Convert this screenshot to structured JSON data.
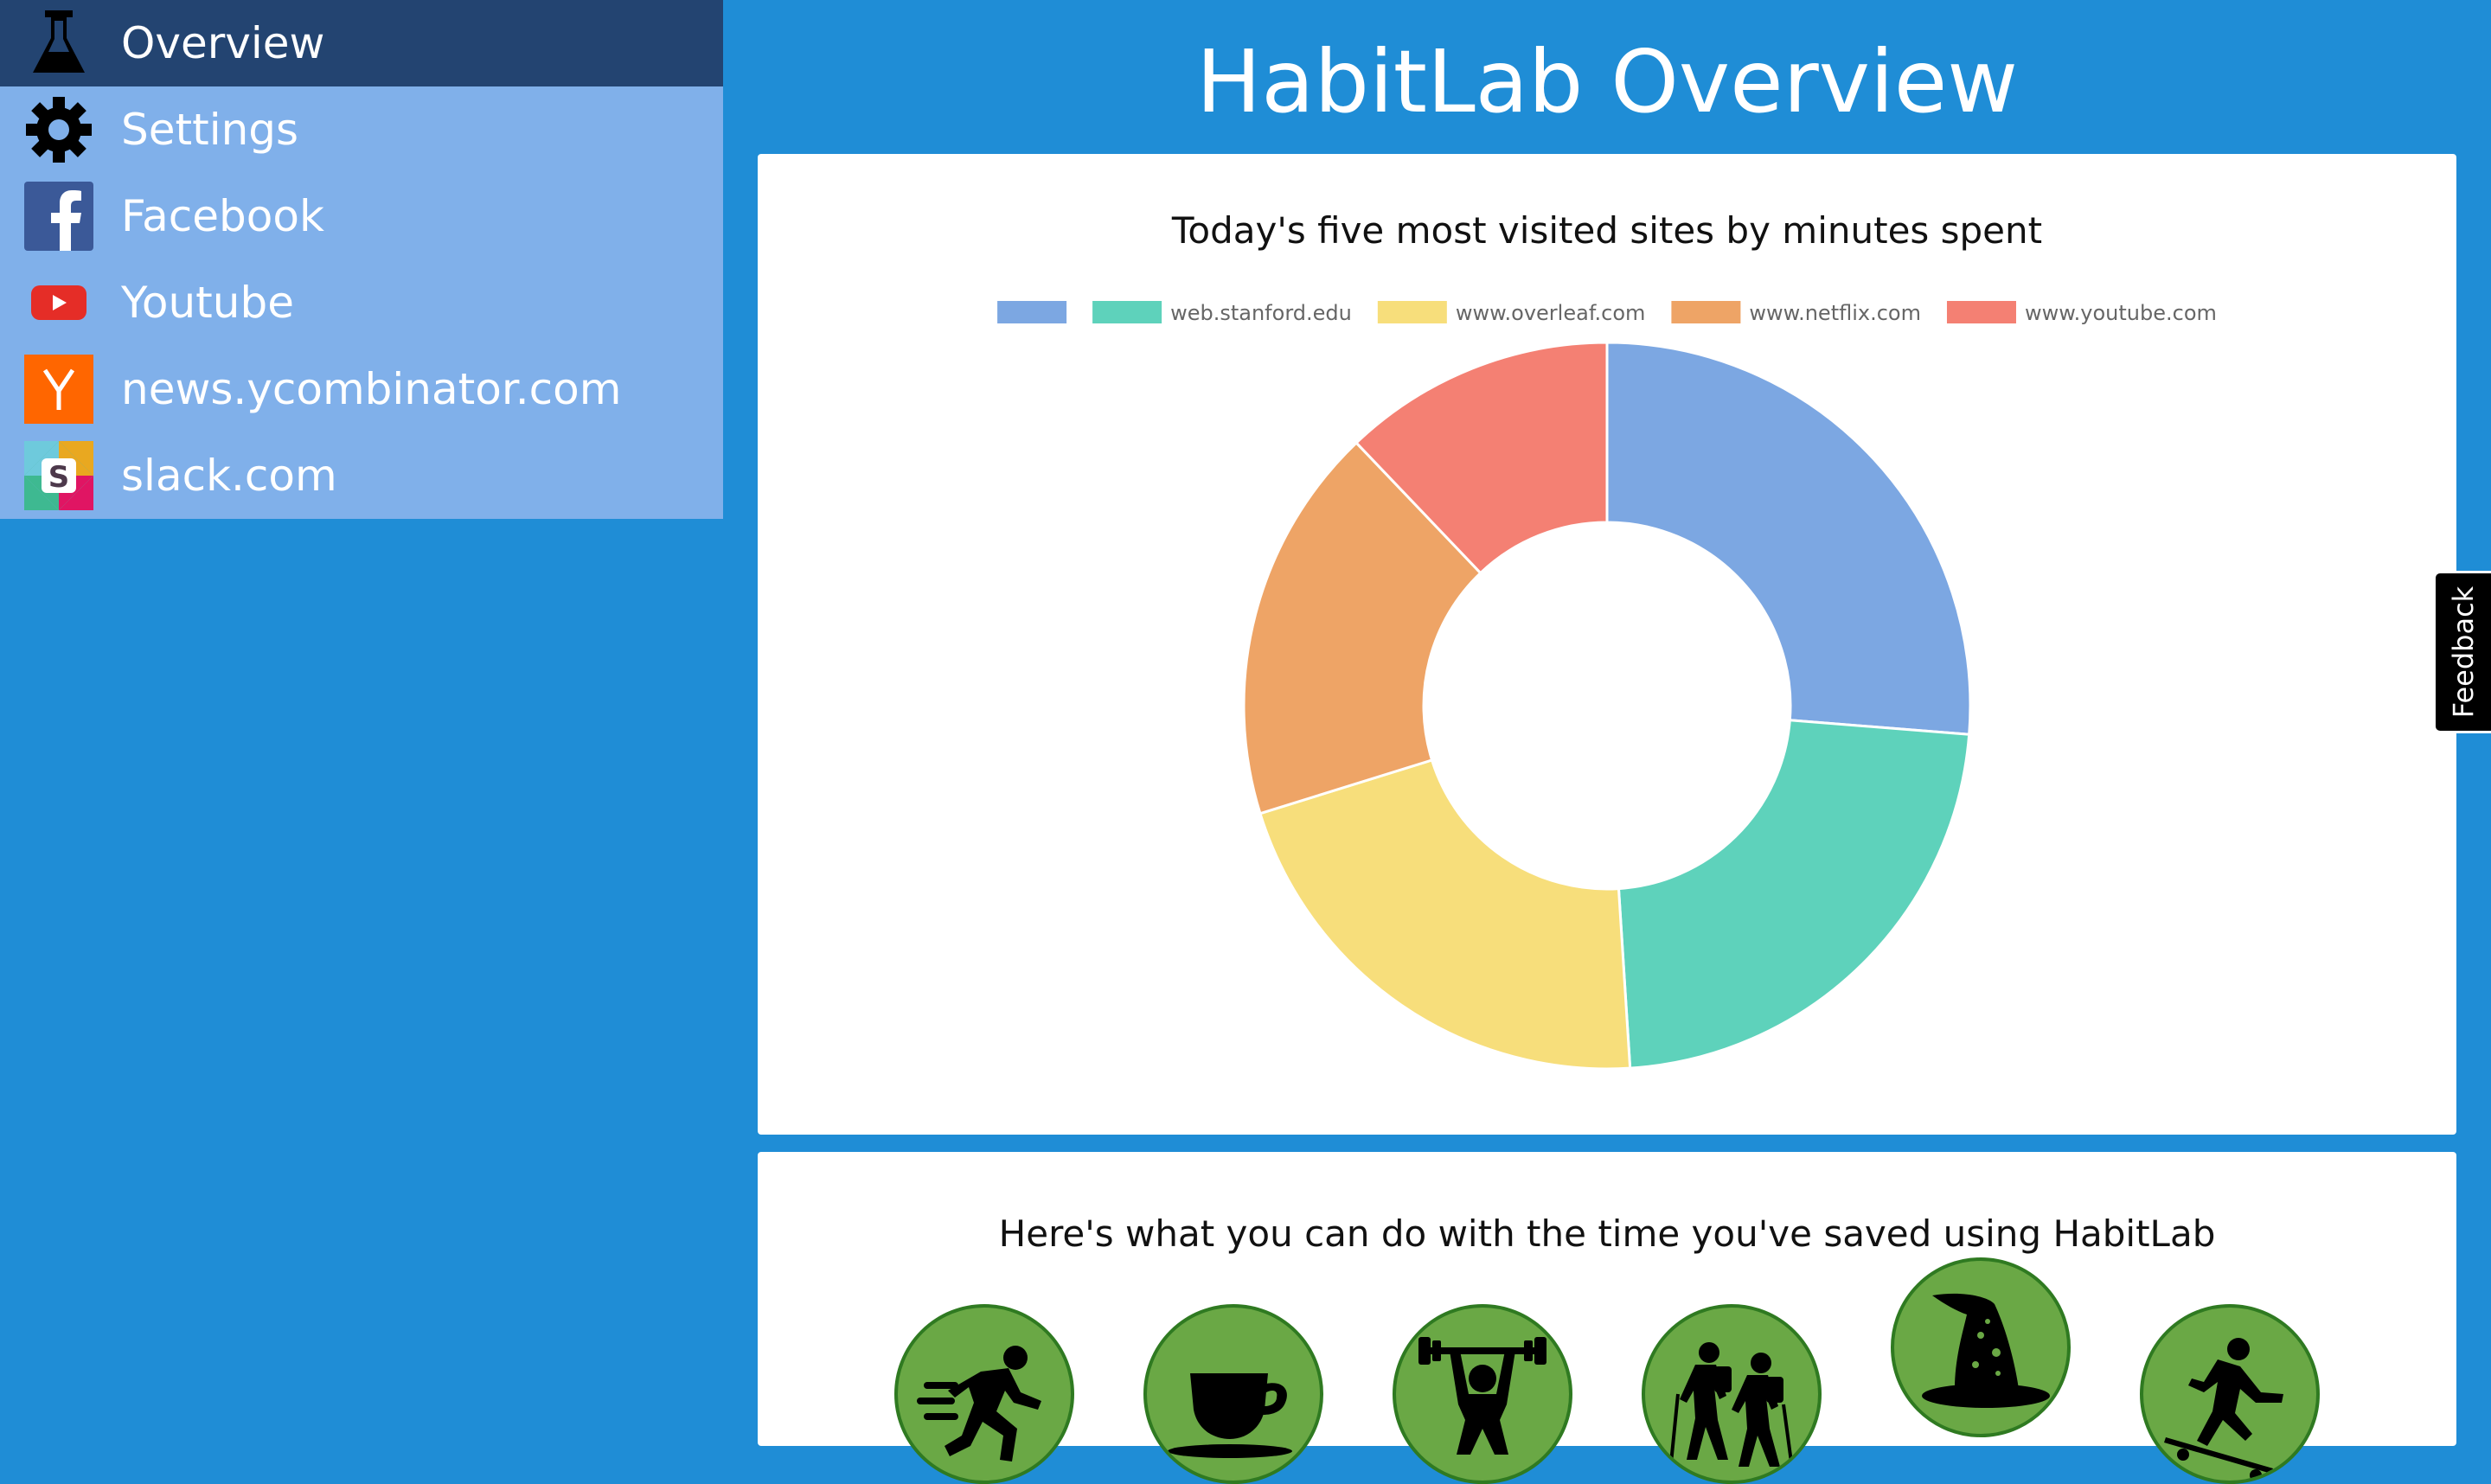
{
  "sidebar": {
    "items": [
      {
        "label": "Overview",
        "icon": "flask-icon",
        "active": true
      },
      {
        "label": "Settings",
        "icon": "gear-icon",
        "active": false
      },
      {
        "label": "Facebook",
        "icon": "facebook-icon",
        "active": false
      },
      {
        "label": "Youtube",
        "icon": "youtube-icon",
        "active": false
      },
      {
        "label": "news.ycombinator.com",
        "icon": "ycombinator-icon",
        "active": false
      },
      {
        "label": "slack.com",
        "icon": "slack-icon",
        "active": false
      }
    ]
  },
  "header": {
    "title": "HabitLab Overview"
  },
  "chart_card": {
    "heading": "Today's five most visited sites by minutes spent"
  },
  "activities_card": {
    "heading": "Here's what you can do with the time you've saved using HabitLab",
    "activities": [
      {
        "icon": "running-person-icon"
      },
      {
        "icon": "coffee-cup-icon"
      },
      {
        "icon": "weightlifter-icon"
      },
      {
        "icon": "hikers-icon"
      },
      {
        "icon": "wizard-hat-icon"
      },
      {
        "icon": "skateboarder-icon"
      }
    ]
  },
  "feedback": {
    "label": "Feedback"
  },
  "colors": {
    "background": "#1f8dd6",
    "sidebar": "#80b0ea",
    "sidebar_active": "#234471",
    "activity_green": "#6aa845"
  },
  "chart_data": {
    "type": "pie",
    "variant": "doughnut",
    "title": "Today's five most visited sites by minutes spent",
    "legend_position": "top",
    "categories": [
      "",
      "web.stanford.edu",
      "www.overleaf.com",
      "www.netflix.com",
      "www.youtube.com"
    ],
    "values": [
      26,
      22.5,
      21,
      17.5,
      12
    ],
    "colors": [
      "#7ca7e2",
      "#5ed2bb",
      "#f7de7b",
      "#eea466",
      "#f48073"
    ]
  }
}
